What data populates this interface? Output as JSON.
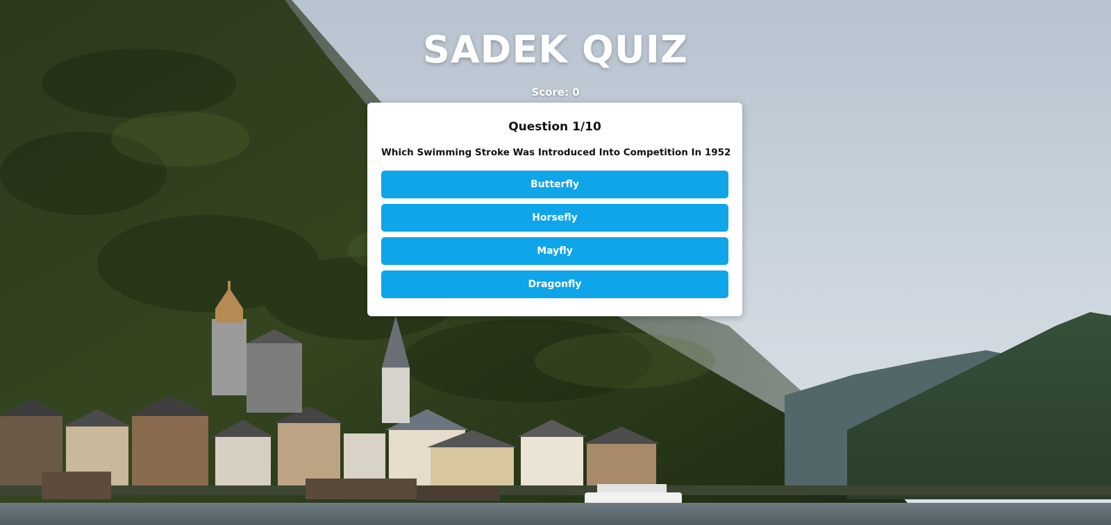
{
  "app": {
    "title": "SADEK QUIZ",
    "score_text": "Score: 0"
  },
  "quiz": {
    "question_label": "Question 1/10",
    "question_text": "Which Swimming Stroke Was Introduced Into Competition In 1952",
    "answers": [
      {
        "label": "Butterfly"
      },
      {
        "label": "Horsefly"
      },
      {
        "label": "Mayfly"
      },
      {
        "label": "Dragonfly"
      }
    ]
  },
  "colors": {
    "answer_button": "#0ea5e9",
    "card": "#ffffff",
    "title": "#ffffff"
  }
}
